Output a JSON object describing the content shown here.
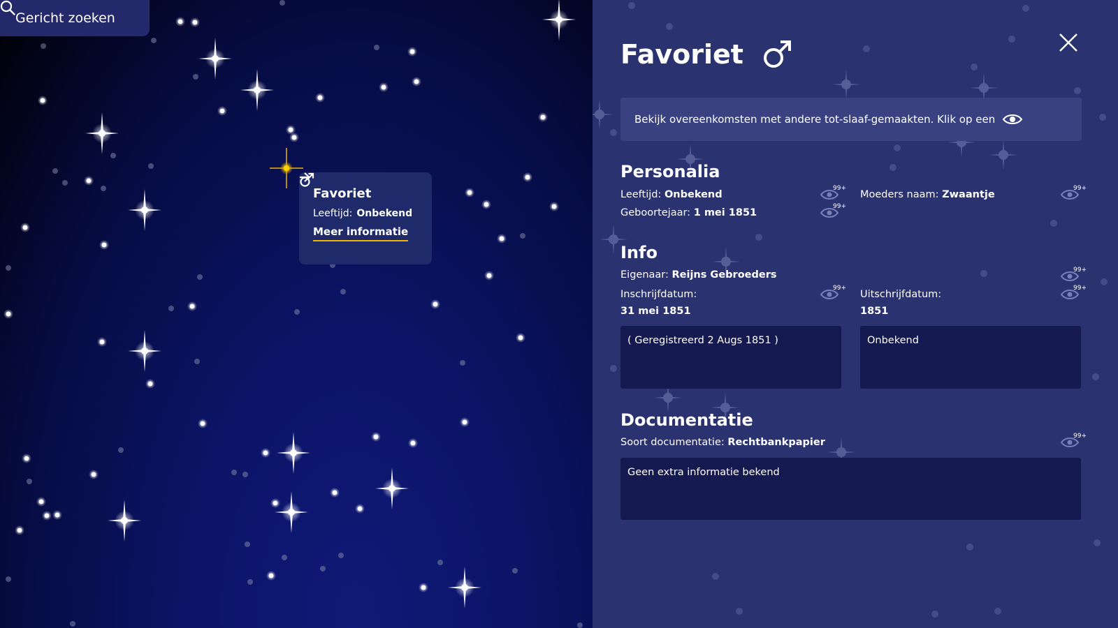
{
  "search": {
    "label": "Gericht zoeken",
    "icon": "search-icon"
  },
  "popup": {
    "title": "Favoriet",
    "age_label": "Leeftijd:",
    "age_value": "Onbekend",
    "more_label": "Meer informatie",
    "accent": "#f0b400"
  },
  "panel": {
    "title": "Favoriet",
    "gender_icon": "male-symbol-icon",
    "banner_text": "Bekijk overeenkomsten met andere tot-slaaf-gemaakten. Klik op een",
    "eye_count": "99+",
    "personalia": {
      "heading": "Personalia",
      "age_label": "Leeftijd:",
      "age_value": "Onbekend",
      "birth_label": "Geboortejaar:",
      "birth_value": "1 mei 1851",
      "mother_label": "Moeders naam:",
      "mother_value": "Zwaantje"
    },
    "info": {
      "heading": "Info",
      "owner_label": "Eigenaar:",
      "owner_value": "Reijns Gebroeders",
      "in_label": "Inschrijfdatum:",
      "in_value": "31 mei 1851",
      "out_label": "Uitschrijfdatum:",
      "out_value": "1851",
      "in_note": "( Geregistreerd 2 Augs 1851 )",
      "out_note": "Onbekend"
    },
    "docs": {
      "heading": "Documentatie",
      "type_label": "Soort documentatie:",
      "type_value": "Rechtbankpapier",
      "note": "Geen extra informatie bekend"
    }
  },
  "colors": {
    "panel_bg": "#2b3270",
    "sky_dark": "#000004",
    "sky_mid": "#0b1465",
    "highlight_star": "#f0b400"
  }
}
